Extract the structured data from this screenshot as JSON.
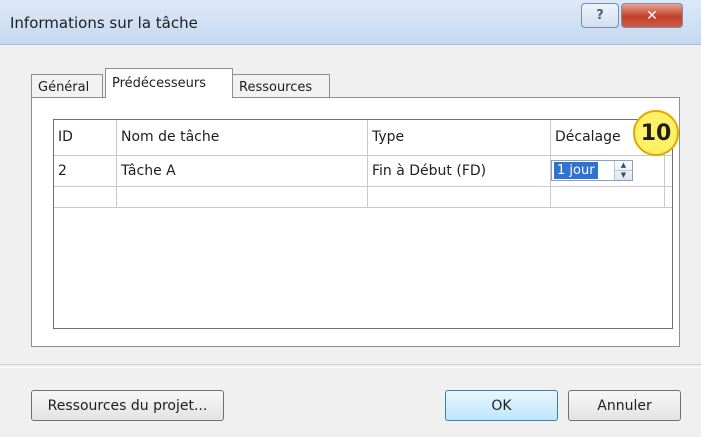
{
  "window": {
    "title": "Informations sur la tâche",
    "help_glyph": "?",
    "close_glyph": "✕"
  },
  "tabs": [
    {
      "label": "Général"
    },
    {
      "label": "Prédécesseurs",
      "active": true
    },
    {
      "label": "Ressources"
    }
  ],
  "table": {
    "columns": [
      "ID",
      "Nom de tâche",
      "Type",
      "Décalage"
    ],
    "rows": [
      {
        "id": "2",
        "task_name": "Tâche A",
        "type": "Fin à Début (FD)",
        "lag": "1 jour"
      }
    ]
  },
  "annotation": {
    "label": "10"
  },
  "buttons": {
    "project_resources": "Ressources du projet...",
    "ok": "OK",
    "cancel": "Annuler"
  },
  "icons": {
    "spin_up": "▲",
    "spin_down": "▼"
  },
  "colors": {
    "selection": "#3072cf",
    "annotation_fill": "#fff166"
  }
}
